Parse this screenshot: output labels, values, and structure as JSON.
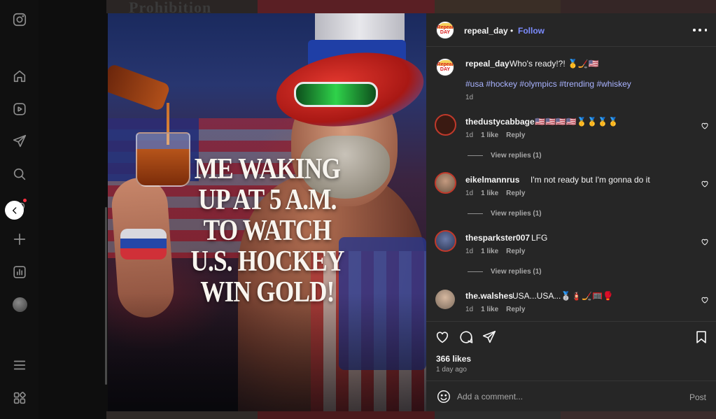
{
  "nav": {
    "items": [
      {
        "name": "instagram-icon"
      },
      {
        "name": "home-icon"
      },
      {
        "name": "reels-icon"
      },
      {
        "name": "messages-icon"
      },
      {
        "name": "search-icon"
      },
      {
        "name": "create-icon"
      },
      {
        "name": "dashboard-icon"
      },
      {
        "name": "profile-avatar"
      },
      {
        "name": "menu-icon"
      },
      {
        "name": "more-apps-icon"
      }
    ]
  },
  "backdrop": {
    "top_text": "Prohibition"
  },
  "post": {
    "image_text": [
      "ME WAKING",
      "UP AT 5 A.M.",
      "TO WATCH",
      "U.S. HOCKEY",
      "WIN GOLD!"
    ],
    "author": "repeal_day",
    "follow_label": "Follow",
    "avatar_label": "Repeal DAY",
    "caption_user": "repeal_day",
    "caption_text": "Who's ready!?! 🥇🏒🇺🇸",
    "hashtags": "#usa #hockey #olympics #trending #whiskey",
    "caption_age": "1d",
    "likes": "366 likes",
    "posted_ago": "1 day ago"
  },
  "comments": [
    {
      "user": "thedustycabbage",
      "text": "🇺🇸🇺🇸🇺🇸🇺🇸🥇🥇🥇🥇",
      "age": "1d",
      "likes": "1 like",
      "reply": "Reply",
      "view_replies": "View replies (1)",
      "avatar_color": "#3a1a12"
    },
    {
      "user": "eikelmannrus",
      "text": "I'm not ready but I'm gonna do it",
      "age": "1d",
      "likes": "1 like",
      "reply": "Reply",
      "view_replies": "View replies (1)",
      "avatar_color": "#6b5644"
    },
    {
      "user": "thesparkster007",
      "text": "LFG",
      "age": "1d",
      "likes": "1 like",
      "reply": "Reply",
      "view_replies": "View replies (1)",
      "avatar_color": "#2b3452"
    },
    {
      "user": "the.walshes",
      "text": "USA...USA...🥈🧯🏒🥅🥊",
      "age": "1d",
      "likes": "1 like",
      "reply": "Reply",
      "avatar_color": "#7a6a5c"
    }
  ],
  "comment_box": {
    "placeholder": "Add a comment...",
    "post_label": "Post"
  },
  "colors": {
    "link_blue": "#7c8cff",
    "hashtag": "#a9b3ff",
    "panel_bg": "#262626",
    "notification": "#ff3040"
  }
}
